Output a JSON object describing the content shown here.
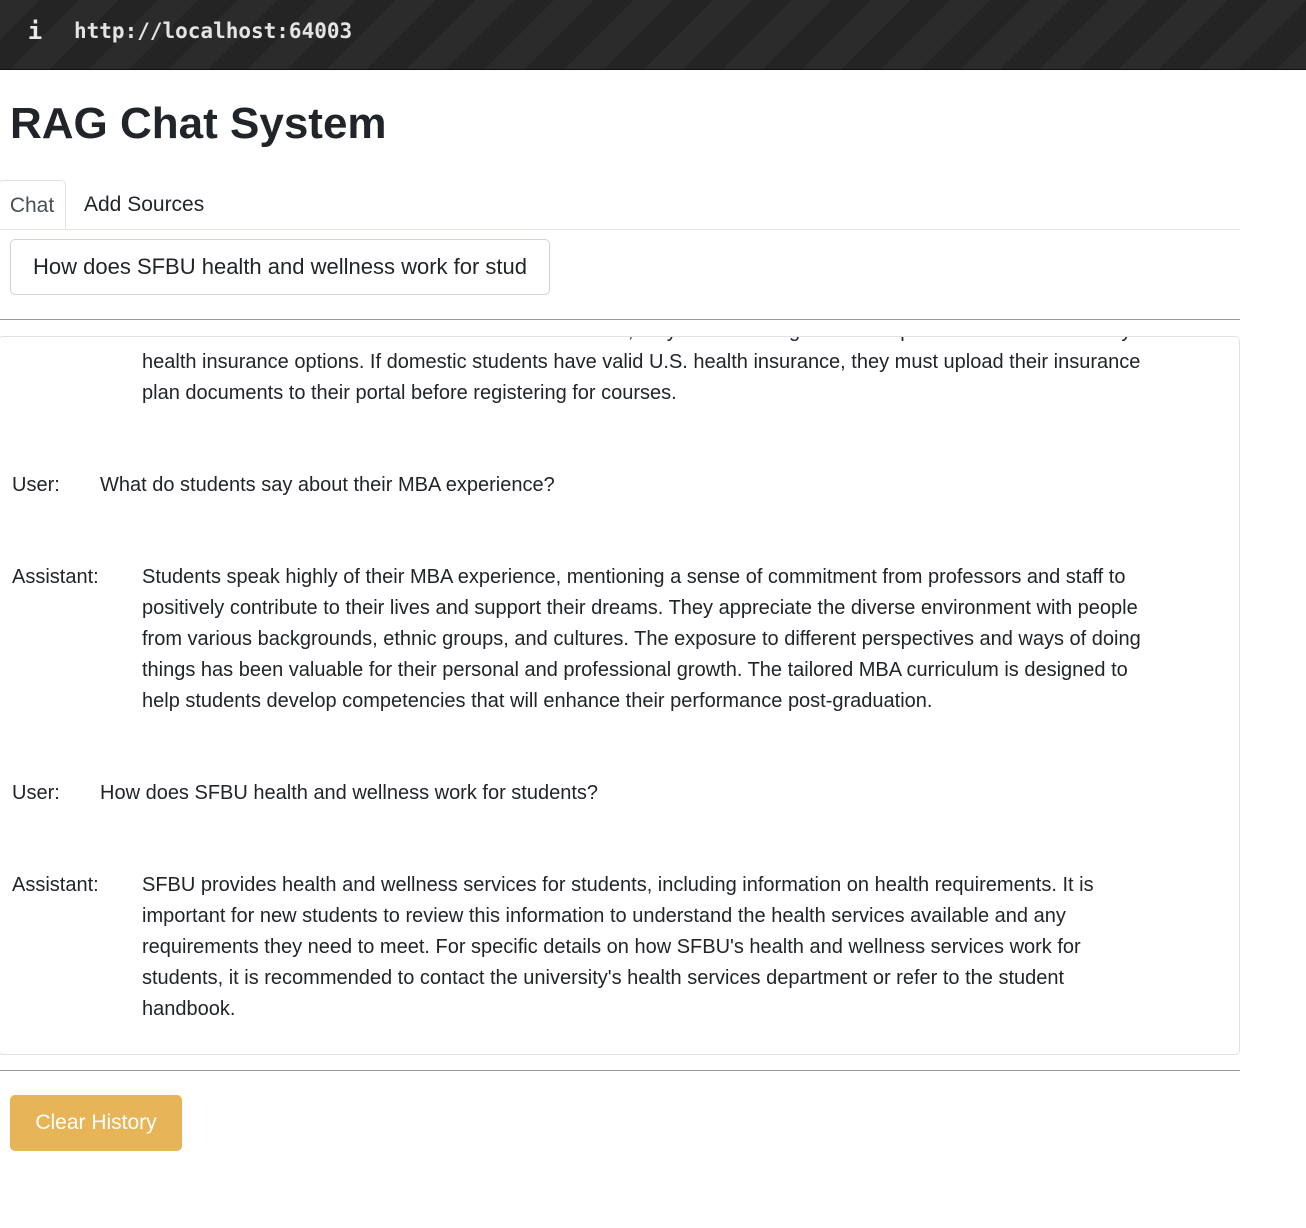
{
  "browser": {
    "info_icon": "info-icon",
    "url": "http://localhost:64003"
  },
  "page": {
    "title": "RAG Chat System"
  },
  "tabs": [
    {
      "label": "Chat",
      "active": true
    },
    {
      "label": "Add Sources",
      "active": false
    }
  ],
  "query": {
    "value": "How does SFBU health and wellness work for students?"
  },
  "chat": {
    "messages": [
      {
        "speaker": "",
        "lines": [
          "International Student Insurance. For domestic students, they are encouraged to visit specific websites to identify",
          "health insurance options. If domestic students have valid U.S. health insurance, they must upload their insurance",
          "plan documents to their portal before registering for courses."
        ]
      },
      {
        "speaker": "User:",
        "lines": [
          "What do students say about their MBA experience?"
        ]
      },
      {
        "speaker": "Assistant:",
        "lines": [
          "Students speak highly of their MBA experience, mentioning a sense of commitment from professors and staff to",
          "positively contribute to their lives and support their dreams. They appreciate the diverse environment with people",
          "from various backgrounds, ethnic groups, and cultures. The exposure to different perspectives and ways of doing",
          "things has been valuable for their personal and professional growth. The tailored MBA curriculum is designed to",
          "help students develop competencies that will enhance their performance post-graduation."
        ]
      },
      {
        "speaker": "User:",
        "lines": [
          "How does SFBU health and wellness work for students?"
        ]
      },
      {
        "speaker": "Assistant:",
        "lines": [
          "SFBU provides health and wellness services for students, including information on health requirements. It is",
          "important for new students to review this information to understand the health services available and any",
          "requirements they need to meet. For specific details on how SFBU's health and wellness services work for",
          "students, it is recommended to contact the university's health services department or refer to the student",
          "handbook."
        ]
      }
    ]
  },
  "actions": {
    "clear_label": "Clear History",
    "clear_color": "#e7b458"
  }
}
